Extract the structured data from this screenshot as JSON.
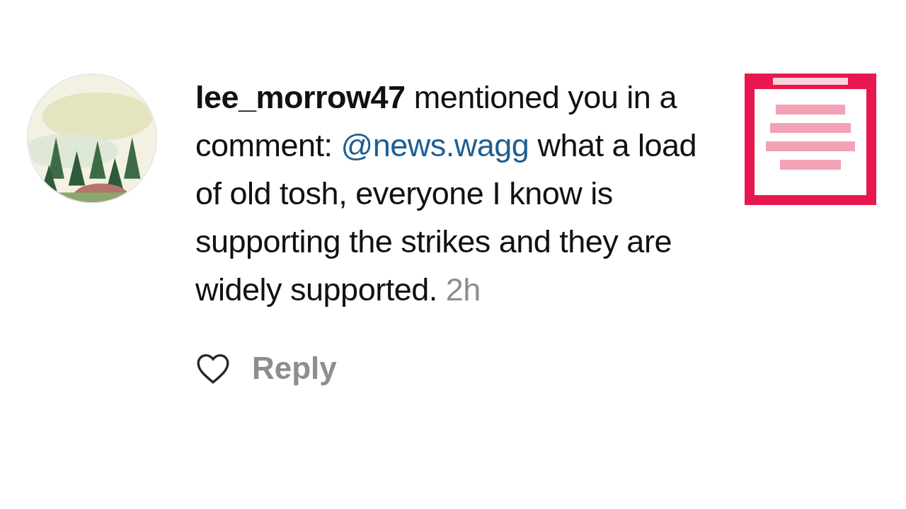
{
  "notification": {
    "message": "**lee_morrow47** mentioned you in a comment:",
    "mention": "@news.wagg",
    "comment": "what a load of old tosh, everyone I know is supporting the strikes and they are widely supported.",
    "time": "2h",
    "liked": false,
    "reply_label": "Reply"
  }
}
